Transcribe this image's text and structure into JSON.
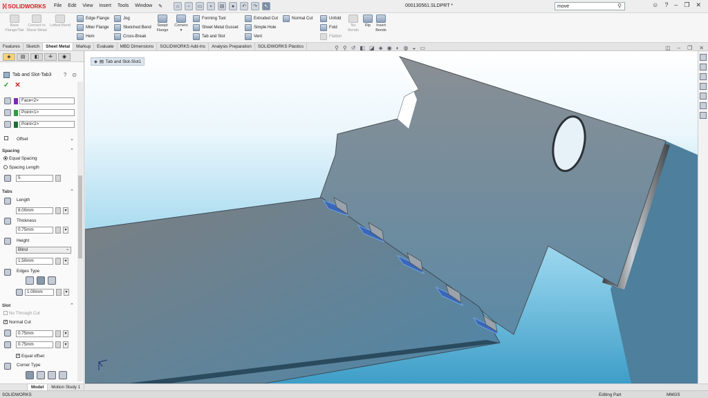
{
  "app": {
    "name": "SOLIDWORKS",
    "document_title": "000130561.SLDPRT *"
  },
  "menu": [
    "File",
    "Edit",
    "View",
    "Insert",
    "Tools",
    "Window"
  ],
  "search": {
    "value": "move"
  },
  "ribbon": {
    "big": [
      {
        "label": "Base Flange/Tab",
        "disabled": true
      },
      {
        "label": "Convert to Sheet Metal",
        "disabled": true
      },
      {
        "label": "Lofted-Bend",
        "disabled": true
      },
      {
        "label": "Swept Flange",
        "disabled": false
      },
      {
        "label": "Corners",
        "disabled": false
      },
      {
        "label": "Unfold",
        "disabled": false
      },
      {
        "label": "No Bends",
        "disabled": true
      },
      {
        "label": "Rip",
        "disabled": false
      },
      {
        "label": "Insert Bends",
        "disabled": false
      }
    ],
    "small": [
      "Edge Flange",
      "Miter Flange",
      "Hem",
      "Jog",
      "Sketched Bend",
      "Cross-Break",
      "Forming Tool",
      "Sheet Metal Gusset",
      "Tab and Slot",
      "Extruded Cut",
      "Simple Hole",
      "Vent",
      "Normal Cut",
      "Fold",
      "Flatten"
    ]
  },
  "tabs": [
    "Features",
    "Sketch",
    "Sheet Metal",
    "Markup",
    "Evaluate",
    "MBD Dimensions",
    "SOLIDWORKS Add-Ins",
    "Analysis Preparation",
    "SOLIDWORKS Plastics"
  ],
  "active_tab": "Sheet Metal",
  "breadcrumb": "Tab and Slot-Slot1",
  "property_manager": {
    "title": "Tab and Slot-Tab3",
    "selections": [
      {
        "value": "Face<2>",
        "color": "#7a2bb5"
      },
      {
        "value": "Point<1>",
        "color": "#2e9e3e"
      },
      {
        "value": "Point<2>",
        "color": "#1f6d3a"
      }
    ],
    "offset": {
      "label": "Offset"
    },
    "spacing": {
      "label": "Spacing",
      "equal": "Equal Spacing",
      "length": "Spacing Length",
      "count": "5"
    },
    "tabs_group": {
      "label": "Tabs",
      "length_label": "Length",
      "length": "8.00mm",
      "thickness_label": "Thickness",
      "thickness": "0.75mm",
      "height_label": "Height",
      "height_type": "Blind",
      "height": "1.50mm",
      "edges_type_label": "Edges Type",
      "edge_value": "1.00mm"
    },
    "slot": {
      "label": "Slot",
      "no_through": "No Through Cut",
      "normal_cut": "Normal Cut",
      "v1": "0.75mm",
      "v2": "0.75mm",
      "equal_offset": "Equal offset",
      "corner_type": "Corner Type"
    }
  },
  "bottom_tabs": [
    "Model",
    "Motion Study 1"
  ],
  "status": {
    "left": "SOLIDWORKS",
    "mode": "Editing Part",
    "units": "MMGS"
  },
  "colors": {
    "accent": "#d02020",
    "viewport_bottom": "#3e9ec8",
    "part": "#7f8b94"
  }
}
